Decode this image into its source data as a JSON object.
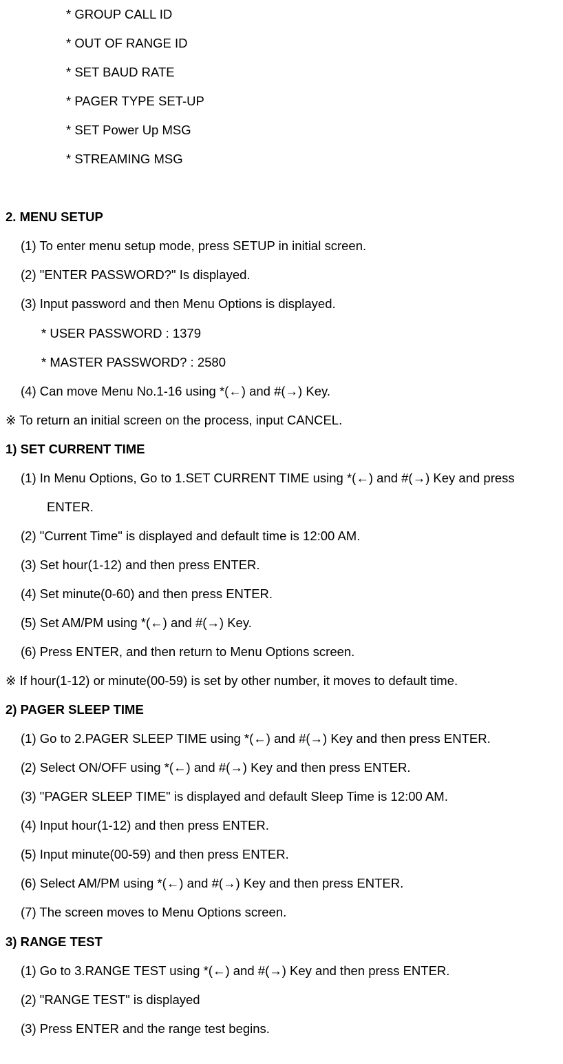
{
  "intro_bullets": [
    "* GROUP CALL ID",
    "* OUT OF RANGE ID",
    "* SET BAUD RATE",
    "* PAGER TYPE SET-UP",
    "* SET Power Up MSG",
    "* STREAMING MSG"
  ],
  "section2": {
    "heading": "2. MENU SETUP",
    "steps": [
      "(1) To enter menu setup mode, press SETUP in initial screen.",
      "(2) \"ENTER PASSWORD?\" Is displayed.",
      "(3) Input password and then Menu Options is displayed."
    ],
    "passwords": [
      "* USER PASSWORD : 1379",
      "* MASTER PASSWORD? : 2580"
    ],
    "step4": "(4) Can move Menu No.1-16 using *(←) and #(→) Key.",
    "note": "※ To return an initial screen on the process, input CANCEL."
  },
  "sub1": {
    "heading": "1) SET CURRENT TIME",
    "step1a": "(1) In Menu Options, Go to 1.SET CURRENT TIME using *(←) and #(→) Key and press",
    "step1b": "ENTER.",
    "steps_rest": [
      "(2) \"Current Time\" is displayed and default time is 12:00 AM.",
      "(3) Set hour(1-12) and then press ENTER.",
      "(4) Set minute(0-60) and then press ENTER.",
      "(5) Set AM/PM using *(←) and #(→) Key.",
      "(6) Press ENTER, and then return to Menu Options screen."
    ],
    "note": "※ If hour(1-12) or minute(00-59) is set by other number, it moves to default time."
  },
  "sub2": {
    "heading": "2) PAGER SLEEP TIME",
    "steps": [
      "(1) Go to 2.PAGER SLEEP TIME using *(←) and #(→) Key and then press ENTER.",
      "(2) Select ON/OFF using *(←) and #(→) Key and then press ENTER.",
      "(3) \"PAGER SLEEP TIME\" is displayed and default Sleep Time is 12:00 AM.",
      "(4) Input hour(1-12) and then press ENTER.",
      "(5) Input minute(00-59) and then press ENTER.",
      "(6) Select AM/PM using *(←) and #(→) Key and then press ENTER.",
      "(7) The screen moves to Menu Options screen."
    ]
  },
  "sub3": {
    "heading": "3) RANGE TEST",
    "steps": [
      "(1) Go to 3.RANGE TEST using *(←) and #(→) Key and then press ENTER.",
      "(2) \"RANGE TEST\" is displayed",
      "(3) Press ENTER and the range test begins."
    ]
  }
}
